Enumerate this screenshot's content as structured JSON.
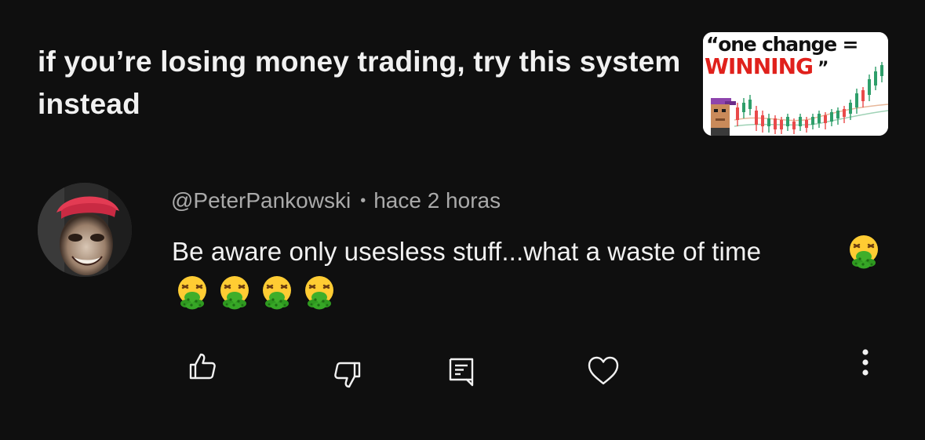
{
  "video": {
    "title": "if you’re losing money trading, try this system instead",
    "thumbnail": {
      "line1": "“one change =",
      "line2": "WINNING",
      "line2_suffix": "”",
      "accent_color": "#e0211c"
    }
  },
  "comment": {
    "author": "@PeterPankowski",
    "separator": "•",
    "timestamp": "hace 2 horas",
    "text": "Be aware only usesless stuff...what a waste of time",
    "emoji_name": "nauseated-face-vomiting",
    "emoji_count": 5
  },
  "actions": {
    "like": "thumbs-up-icon",
    "dislike": "thumbs-down-icon",
    "reply": "comment-icon",
    "heart": "heart-icon",
    "more": "more-vertical-icon"
  },
  "colors": {
    "background": "#0f0f0f",
    "primary_text": "#f1f1f1",
    "secondary_text": "#aaaaaa"
  }
}
